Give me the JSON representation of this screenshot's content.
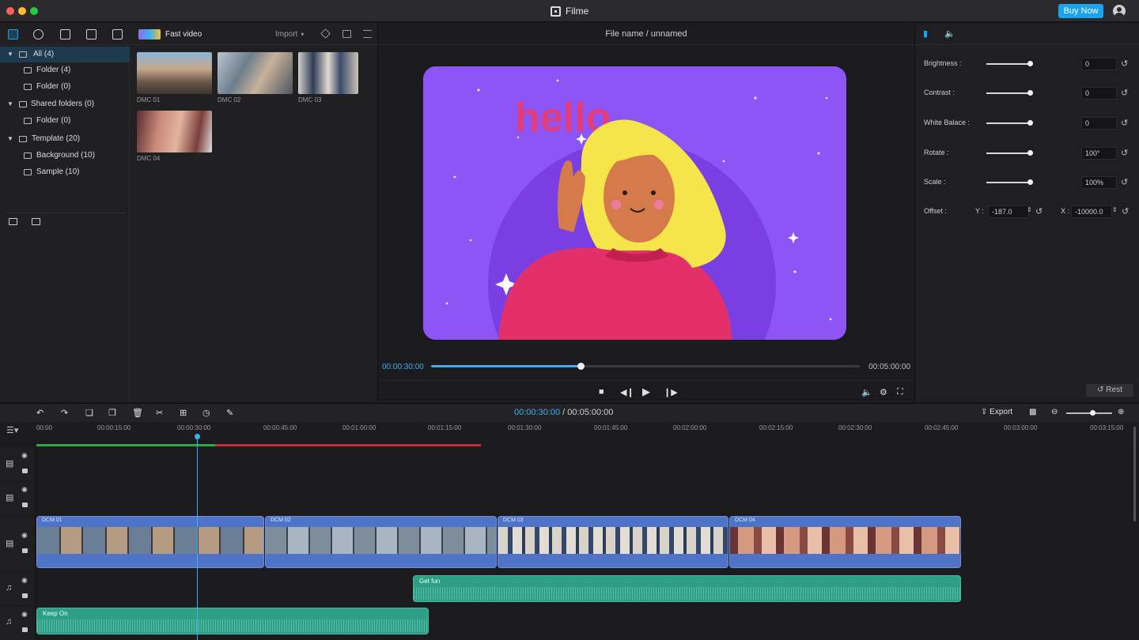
{
  "app": {
    "title": "Filme",
    "buy_label": "Buy Now"
  },
  "library": {
    "fast_video_label": "Fast video",
    "import_label": "Import",
    "tree": [
      {
        "label": "All (4)",
        "selected": true
      },
      {
        "label": "Folder (4)"
      },
      {
        "label": "Folder (0)"
      },
      {
        "label": "Shared folders (0)"
      },
      {
        "label": "Folder (0)"
      },
      {
        "label": "Template (20)"
      },
      {
        "label": "Background (10)"
      },
      {
        "label": "Sample (10)"
      }
    ],
    "media": [
      {
        "label": "DMC 01"
      },
      {
        "label": "DMC 02"
      },
      {
        "label": "DMC 03"
      },
      {
        "label": "DMC 04"
      }
    ]
  },
  "preview": {
    "file_title": "File name / unnamed",
    "canvas_text": "hello",
    "current_time": "00:00:30:00",
    "total_time": "00:05:00:00",
    "progress": 0.35
  },
  "properties": {
    "rows": [
      {
        "label": "Brightness :",
        "value": "0",
        "level": 0.95
      },
      {
        "label": "Contrast :",
        "value": "0",
        "level": 0.95
      },
      {
        "label": "White Balace :",
        "value": "0",
        "level": 0.95
      },
      {
        "label": "Rotate :",
        "value": "100°",
        "level": 0.95
      },
      {
        "label": "Scale :",
        "value": "100%",
        "level": 0.95
      }
    ],
    "offset": {
      "label": "Offset :",
      "y_label": "Y :",
      "y_value": "-187.0",
      "x_label": "X :",
      "x_value": "-10000.0"
    },
    "rest_label": "Rest"
  },
  "timeline": {
    "current_time": "00:00:30:00",
    "separator": " / ",
    "total_time": "00:05:00:00",
    "export_label": "Export",
    "ticks": [
      "00:00",
      "00:00:15:00",
      "00:00:30:00",
      "00:00:45:00",
      "00:01:00:00",
      "00:01:15:00",
      "00:01:30:00",
      "00:01:45:00",
      "00:02:00:00",
      "00:02:15:00",
      "00:02:30:00",
      "00:02:45:00",
      "00:03:00:00",
      "00:03:15:00"
    ],
    "video_clips": [
      {
        "name": "DCM 01"
      },
      {
        "name": "DCM 02"
      },
      {
        "name": "DCM 03"
      },
      {
        "name": "DCM 04"
      }
    ],
    "audio_clips": [
      {
        "name": "Get fun"
      },
      {
        "name": "Keep On"
      }
    ]
  },
  "colors": {
    "accent": "#1aa3f0",
    "video_clip": "#4d74c8",
    "audio_clip": "#2f9e86",
    "canvas_bg": "#8b5cf6"
  }
}
